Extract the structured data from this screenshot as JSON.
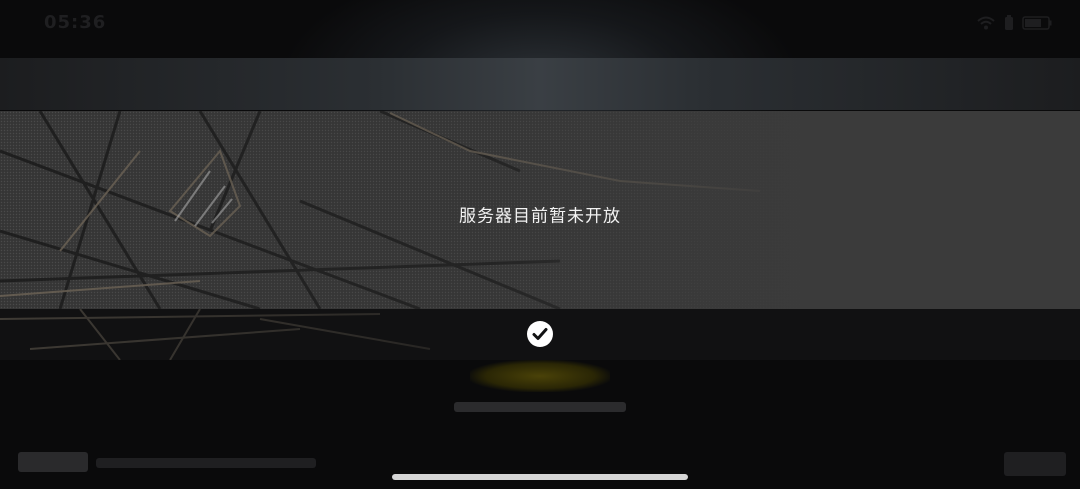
{
  "status_bar": {
    "time": "05:36",
    "icons": [
      "wifi-icon",
      "battery-saver-icon",
      "battery-icon"
    ]
  },
  "dialog": {
    "message": "服务器目前暂未开放",
    "confirm_icon": "checkmark-icon"
  },
  "colors": {
    "dialog_body": "#3b3b3b",
    "dialog_footer": "#111112",
    "message_text": "#f2f2f2",
    "confirm_button": "#ffffff"
  }
}
